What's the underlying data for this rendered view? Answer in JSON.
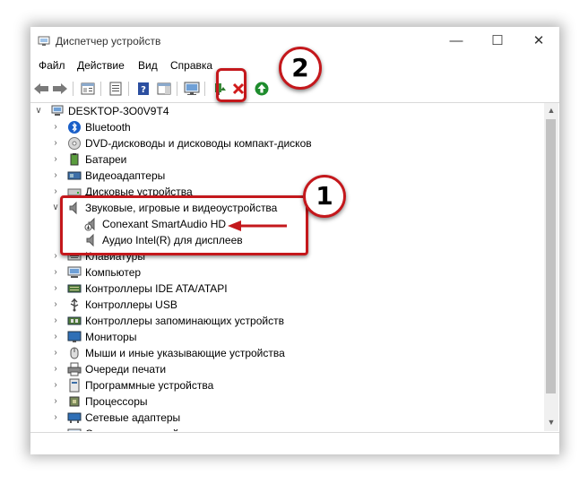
{
  "window": {
    "title": "Диспетчер устройств",
    "minimize_glyph": "—",
    "maximize_glyph": "☐",
    "close_glyph": "✕"
  },
  "menu": [
    "Файл",
    "Действие",
    "Вид",
    "Справка"
  ],
  "toolbar": {
    "icons": [
      "back-arrow-icon",
      "forward-arrow-icon",
      "properties-icon",
      "properties-sheet-icon",
      "help-icon",
      "action-pane-icon",
      "scan-monitor-icon",
      "enable-device-icon",
      "uninstall-device-icon",
      "update-driver-icon"
    ]
  },
  "tree": {
    "root": "DESKTOP-3O0V9T4",
    "categories": [
      {
        "label": "Bluetooth",
        "icon": "bluetooth-icon",
        "expanded": false
      },
      {
        "label": "DVD-дисководы и дисководы компакт-дисков",
        "icon": "dvd-drive-icon",
        "expanded": false
      },
      {
        "label": "Батареи",
        "icon": "battery-icon",
        "expanded": false
      },
      {
        "label": "Видеоадаптеры",
        "icon": "display-adapter-icon",
        "expanded": false
      },
      {
        "label": "Дисковые устройства",
        "icon": "disk-drive-icon",
        "expanded": false
      },
      {
        "label": "Звуковые, игровые и видеоустройства",
        "icon": "speaker-icon",
        "expanded": true,
        "children": [
          {
            "label": "Conexant SmartAudio HD",
            "icon": "speaker-update-icon"
          },
          {
            "label": "Аудио Intel(R) для дисплеев",
            "icon": "speaker-icon"
          }
        ]
      },
      {
        "label": "Клавиатуры",
        "icon": "keyboard-icon",
        "expanded": false
      },
      {
        "label": "Компьютер",
        "icon": "computer-icon",
        "expanded": false
      },
      {
        "label": "Контроллеры IDE ATA/ATAPI",
        "icon": "ide-controller-icon",
        "expanded": false
      },
      {
        "label": "Контроллеры USB",
        "icon": "usb-icon",
        "expanded": false
      },
      {
        "label": "Контроллеры запоминающих устройств",
        "icon": "storage-controller-icon",
        "expanded": false
      },
      {
        "label": "Мониторы",
        "icon": "monitor-icon",
        "expanded": false
      },
      {
        "label": "Мыши и иные указывающие устройства",
        "icon": "mouse-icon",
        "expanded": false
      },
      {
        "label": "Очереди печати",
        "icon": "printer-icon",
        "expanded": false
      },
      {
        "label": "Программные устройства",
        "icon": "software-device-icon",
        "expanded": false
      },
      {
        "label": "Процессоры",
        "icon": "processor-icon",
        "expanded": false
      },
      {
        "label": "Сетевые адаптеры",
        "icon": "network-adapter-icon",
        "expanded": false
      },
      {
        "label": "Системные устройства",
        "icon": "system-device-icon",
        "expanded": false
      }
    ]
  },
  "annotations": {
    "badge_1": "1",
    "badge_2": "2",
    "accent_color": "#c4181c"
  }
}
